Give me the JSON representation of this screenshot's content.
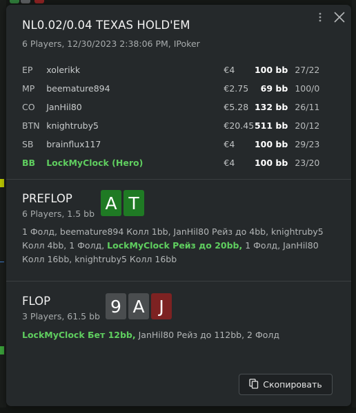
{
  "header": {
    "title": "NL0.02/0.04 TEXAS HOLD'EM",
    "subtitle": "6 Players, 12/30/2023 2:38:06 PM, IPoker"
  },
  "players": [
    {
      "pos": "EP",
      "name": "xolerikk",
      "stack": "€4",
      "bb": "100 bb",
      "ratio": "27/22",
      "hero": false
    },
    {
      "pos": "MP",
      "name": "beemature894",
      "stack": "€2.75",
      "bb": "69 bb",
      "ratio": "100/0",
      "hero": false
    },
    {
      "pos": "CO",
      "name": "JanHil80",
      "stack": "€5.28",
      "bb": "132 bb",
      "ratio": "26/11",
      "hero": false
    },
    {
      "pos": "BTN",
      "name": "knightruby5",
      "stack": "€20.45",
      "bb": "511 bb",
      "ratio": "20/12",
      "hero": false
    },
    {
      "pos": "SB",
      "name": "brainflux117",
      "stack": "€4",
      "bb": "100 bb",
      "ratio": "29/23",
      "hero": false
    },
    {
      "pos": "BB",
      "name": "LockMyClock (Hero)",
      "stack": "€4",
      "bb": "100 bb",
      "ratio": "23/20",
      "hero": true
    }
  ],
  "preflop": {
    "name": "PREFLOP",
    "info": "6 Players, 1.5 bb",
    "cards": [
      {
        "rank": "A",
        "color": "#1f7a24"
      },
      {
        "rank": "T",
        "color": "#1f7a24"
      }
    ],
    "actions": {
      "a1": "1 Фолд, beemature894 Колл 1bb, JanHil80 Рейз до 4bb, knightruby5 Колл 4bb, 1 Фолд,",
      "hero": "LockMyClock Рейз до 20bb,",
      "a2": "1 Фолд, JanHil80 Колл 16bb, knightruby5 Колл 16bb"
    }
  },
  "flop": {
    "name": "FLOP",
    "info": "3 Players, 61.5 bb",
    "cards": [
      {
        "rank": "9",
        "color": "#4a4d4f"
      },
      {
        "rank": "A",
        "color": "#4a4d4f"
      },
      {
        "rank": "J",
        "color": "#7d2222"
      }
    ],
    "actions": {
      "hero": "LockMyClock Бет 12bb,",
      "a1": "JanHil80 Рейз до 112bb, 2 Фолд"
    }
  },
  "footer": {
    "copy_label": "Скопировать"
  },
  "icons": {
    "menu": "more-vertical-icon",
    "close": "close-icon",
    "copy": "copy-icon"
  },
  "colors": {
    "hero": "#5fce5f",
    "card_green": "#1f7a24",
    "card_red": "#7d2222",
    "card_gray": "#4a4d4f"
  }
}
